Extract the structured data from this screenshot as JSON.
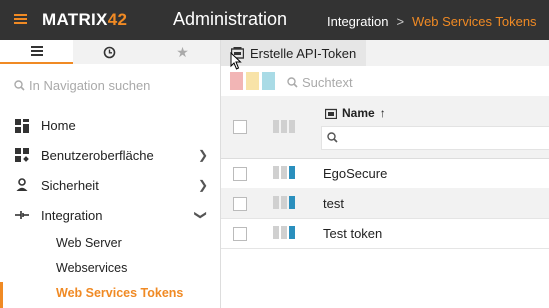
{
  "header": {
    "logo_main": "MATRIX",
    "logo_accent": "42",
    "title": "Administration",
    "breadcrumb": [
      "Integration",
      "Web Services Tokens"
    ],
    "accent_color": "#f08a24"
  },
  "sidebar": {
    "tabs": [
      {
        "icon": "list-icon",
        "glyph": "≡"
      },
      {
        "icon": "history-icon",
        "glyph": "↺"
      },
      {
        "icon": "star-icon",
        "glyph": "★"
      }
    ],
    "search_placeholder": "In Navigation suchen",
    "items": [
      {
        "label": "Home",
        "icon": "dashboard-icon",
        "has_children": false
      },
      {
        "label": "Benutzeroberfläche",
        "icon": "layout-icon",
        "has_children": true
      },
      {
        "label": "Sicherheit",
        "icon": "user-icon",
        "has_children": true
      },
      {
        "label": "Integration",
        "icon": "integration-icon",
        "has_children": true
      }
    ],
    "sub_items": [
      {
        "label": "Web Server"
      },
      {
        "label": "Webservices"
      },
      {
        "label": "Web Services Tokens"
      }
    ]
  },
  "toolbar": {
    "create_label": "Erstelle API-Token"
  },
  "filter": {
    "swatches": [
      "#f2b5b5",
      "#f8e3a8",
      "#a9dbe6"
    ],
    "search_placeholder": "Suchtext"
  },
  "table": {
    "column_name": "Name",
    "sort": "ascending",
    "rows": [
      {
        "name": "EgoSecure"
      },
      {
        "name": "test"
      },
      {
        "name": "Test token"
      }
    ]
  }
}
